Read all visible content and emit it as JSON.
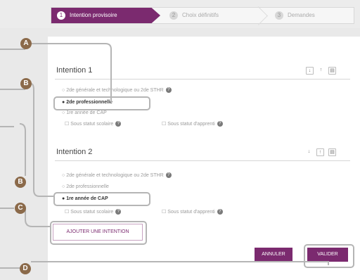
{
  "stepper": {
    "steps": [
      {
        "num": "1",
        "label": "Intention provisoire"
      },
      {
        "num": "2",
        "label": "Choix définitifs"
      },
      {
        "num": "3",
        "label": "Demandes"
      }
    ]
  },
  "intention1": {
    "title": "Intention 1",
    "opt1": "2de générale et technologique ou 2de STHR",
    "opt2": "2de professionnelle",
    "opt3": "1re année de CAP",
    "statut1": "Sous statut scolaire",
    "statut2": "Sous statut d'apprenti"
  },
  "intention2": {
    "title": "Intention 2",
    "opt1": "2de générale et technologique ou 2de STHR",
    "opt2": "2de professionnelle",
    "opt3": "1re année de CAP",
    "statut1": "Sous statut scolaire",
    "statut2": "Sous statut d'apprenti"
  },
  "buttons": {
    "add": "AJOUTER UNE INTENTION",
    "cancel": "ANNULER",
    "validate": "VALIDER"
  },
  "callouts": {
    "a": "A",
    "b1": "B",
    "b2": "B",
    "c": "C",
    "d": "D"
  },
  "colors": {
    "accent": "#7b2a6f",
    "callout": "#8b6a4a"
  }
}
